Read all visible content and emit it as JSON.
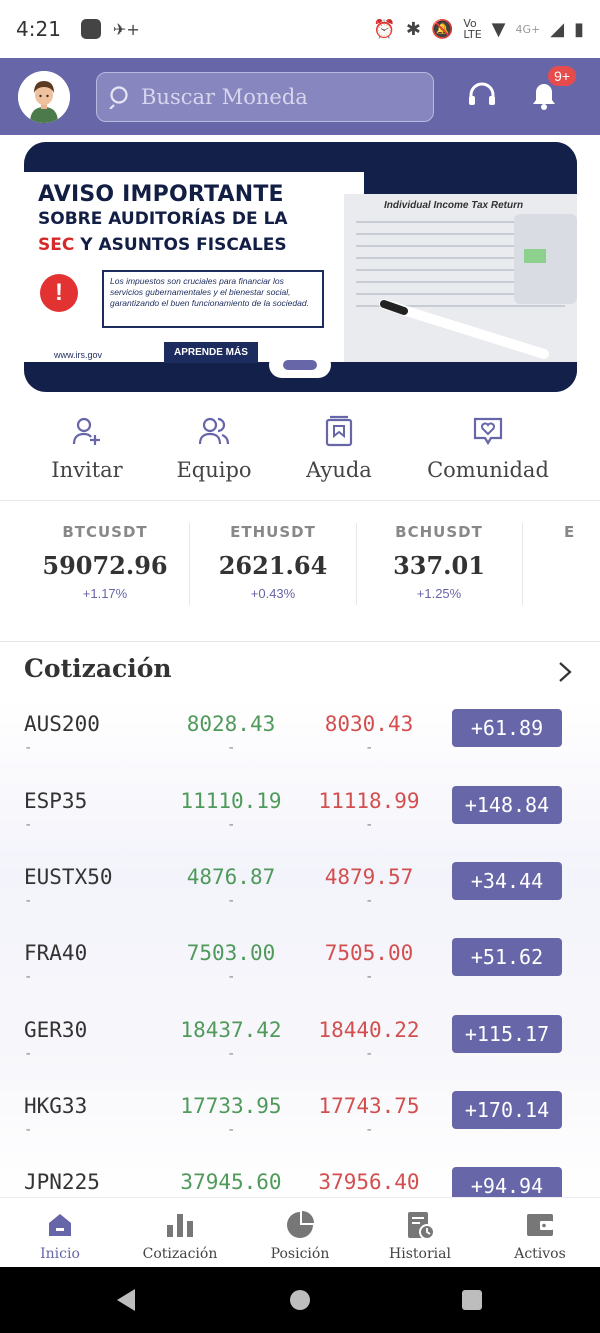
{
  "status_bar": {
    "time": "4:21",
    "net": "4G+"
  },
  "header": {
    "search_placeholder": "Buscar Moneda",
    "notification_badge": "9+",
    "accent": "#6766a8"
  },
  "banner": {
    "line1": "AVISO IMPORTANTE",
    "line2": "SOBRE AUDITORÍAS DE LA",
    "line3_red": "SEC",
    "line3_rest": " Y ASUNTOS FISCALES",
    "body": "Los impuestos son cruciales para financiar los servicios gubernamentales y el bienestar social, garantizando el buen funcionamiento de la sociedad.",
    "url": "www.irs.gov",
    "cta": "APRENDE MÁS",
    "form_title": "Individual Income Tax Return"
  },
  "quick_actions": [
    {
      "label": "Invitar",
      "icon": "add-user-icon"
    },
    {
      "label": "Equipo",
      "icon": "team-icon"
    },
    {
      "label": "Ayuda",
      "icon": "help-book-icon"
    },
    {
      "label": "Comunidad",
      "icon": "community-heart-icon"
    }
  ],
  "tickers": [
    {
      "symbol": "BTCUSDT",
      "price": "59072.96",
      "change": "+1.17%"
    },
    {
      "symbol": "ETHUSDT",
      "price": "2621.64",
      "change": "+0.43%"
    },
    {
      "symbol": "BCHUSDT",
      "price": "337.01",
      "change": "+1.25%"
    },
    {
      "symbol": "E",
      "price": "",
      "change": ""
    }
  ],
  "quotes": {
    "title": "Cotización",
    "rows": [
      {
        "symbol": "AUS200",
        "bid": "8028.43",
        "ask": "8030.43",
        "change": "+61.89",
        "sub": "-"
      },
      {
        "symbol": "ESP35",
        "bid": "11110.19",
        "ask": "11118.99",
        "change": "+148.84",
        "sub": "-"
      },
      {
        "symbol": "EUSTX50",
        "bid": "4876.87",
        "ask": "4879.57",
        "change": "+34.44",
        "sub": "-"
      },
      {
        "symbol": "FRA40",
        "bid": "7503.00",
        "ask": "7505.00",
        "change": "+51.62",
        "sub": "-"
      },
      {
        "symbol": "GER30",
        "bid": "18437.42",
        "ask": "18440.22",
        "change": "+115.17",
        "sub": "-"
      },
      {
        "symbol": "HKG33",
        "bid": "17733.95",
        "ask": "17743.75",
        "change": "+170.14",
        "sub": "-"
      },
      {
        "symbol": "JPN225",
        "bid": "37945.60",
        "ask": "37956.40",
        "change": "+94.94",
        "sub": "-"
      }
    ]
  },
  "bottom_nav": [
    {
      "label": "Inicio",
      "icon": "home-icon",
      "active": true
    },
    {
      "label": "Cotización",
      "icon": "bar-chart-icon",
      "active": false
    },
    {
      "label": "Posición",
      "icon": "pie-chart-icon",
      "active": false
    },
    {
      "label": "Historial",
      "icon": "history-icon",
      "active": false
    },
    {
      "label": "Activos",
      "icon": "wallet-icon",
      "active": false
    }
  ]
}
